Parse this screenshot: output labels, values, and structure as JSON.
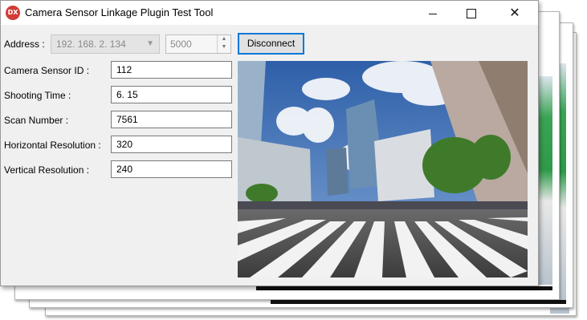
{
  "window": {
    "title": "Camera Sensor Linkage Plugin Test Tool",
    "icon_text": "DX",
    "minimize_icon": "minimize-icon",
    "maximize_icon": "maximize-icon",
    "close_icon": "close-icon",
    "close_glyph": "✕"
  },
  "connection": {
    "address_label": "Address :",
    "address_value": "192. 168. 2. 134",
    "port_value": "5000",
    "disconnect_label": "Disconnect"
  },
  "fields": [
    {
      "label": "Camera Sensor ID :",
      "value": "112"
    },
    {
      "label": "Shooting Time :",
      "value": "6. 15"
    },
    {
      "label": "Scan Number :",
      "value": "7561"
    },
    {
      "label": "Horizontal Resolution :",
      "value": "320"
    },
    {
      "label": "Vertical Resolution :",
      "value": "240"
    }
  ],
  "colors": {
    "accent": "#0078d7",
    "icon_bg": "#d33b35",
    "window_bg": "#f0f0f0"
  }
}
